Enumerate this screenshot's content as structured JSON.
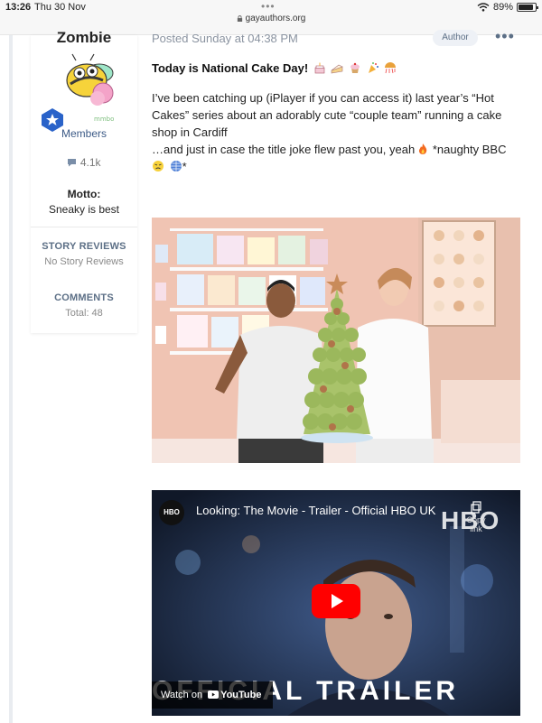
{
  "status_bar": {
    "time": "13:26",
    "date": "Thu 30 Nov",
    "url": "gayauthors.org",
    "battery_text": "89%",
    "battery_level": 0.89
  },
  "author": {
    "name": "Zombie",
    "group": "Members",
    "content_count": "4.1k",
    "motto_label": "Motto:",
    "motto": "Sneaky is best",
    "stats": [
      {
        "title": "STORY REVIEWS",
        "value": "No Story Reviews"
      },
      {
        "title": "COMMENTS",
        "value": "Total: 48"
      }
    ]
  },
  "post": {
    "posted": "Posted Sunday at 04:38 PM",
    "badge": "Author",
    "more": "•••",
    "title": "Today is National Cake Day!",
    "paragraph1": "I’ve been catching up (iPlayer if you can access it) last year’s “Hot Cakes” series about an adorably cute “couple team” running a cake shop in Cardiff",
    "paragraph2": "…and just in case the title joke flew past you, yeah",
    "paragraph2_tail": " *naughty BBC",
    "paragraph3_tail": "*"
  },
  "video": {
    "channel": "HBO",
    "title": "Looking: The Movie - Trailer - Official HBO UK",
    "copy_label": "Copy link",
    "watermark": "HBO",
    "watch_on": "Watch on",
    "youtube": "YouTube",
    "overlay_text": "OFFICIAL TRAILER"
  },
  "colors": {
    "accent": "#3c5a86",
    "muted": "#8a93a0",
    "youtube_red": "#ff0000"
  }
}
